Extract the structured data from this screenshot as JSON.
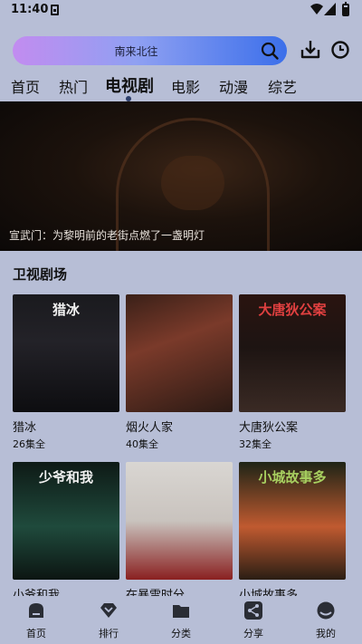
{
  "status_bar": {
    "time": "11:40"
  },
  "search": {
    "text": "南来北往"
  },
  "tabs": [
    {
      "label": "首页"
    },
    {
      "label": "热门"
    },
    {
      "label": "电视剧"
    },
    {
      "label": "电影"
    },
    {
      "label": "动漫"
    },
    {
      "label": "综艺"
    }
  ],
  "active_tab": "电视剧",
  "banner": {
    "caption": "宣武门：为黎明前的老街点燃了一盏明灯"
  },
  "section": {
    "title": "卫视剧场"
  },
  "shows": [
    {
      "title": "猎冰",
      "episodes": "26集全",
      "poster_text": "猎冰"
    },
    {
      "title": "烟火人家",
      "episodes": "40集全",
      "poster_text": ""
    },
    {
      "title": "大唐狄公案",
      "episodes": "32集全",
      "poster_text": "大唐狄公案"
    },
    {
      "title": "小爷和我",
      "episodes": "",
      "poster_text": "少爷和我"
    },
    {
      "title": "在暴雪时分",
      "episodes": "",
      "poster_text": ""
    },
    {
      "title": "小城故事多",
      "episodes": "",
      "poster_text": "小城故事多"
    }
  ],
  "bottom_nav": [
    {
      "label": "首页",
      "icon": "home-icon"
    },
    {
      "label": "排行",
      "icon": "ranking-icon"
    },
    {
      "label": "分类",
      "icon": "folder-icon"
    },
    {
      "label": "分享",
      "icon": "share-icon"
    },
    {
      "label": "我的",
      "icon": "profile-icon"
    }
  ],
  "colors": {
    "background": "#b7bed6",
    "accent": "#2d3f6b",
    "search_gradient_start": "#c28cf0",
    "search_gradient_end": "#3b6fea"
  }
}
